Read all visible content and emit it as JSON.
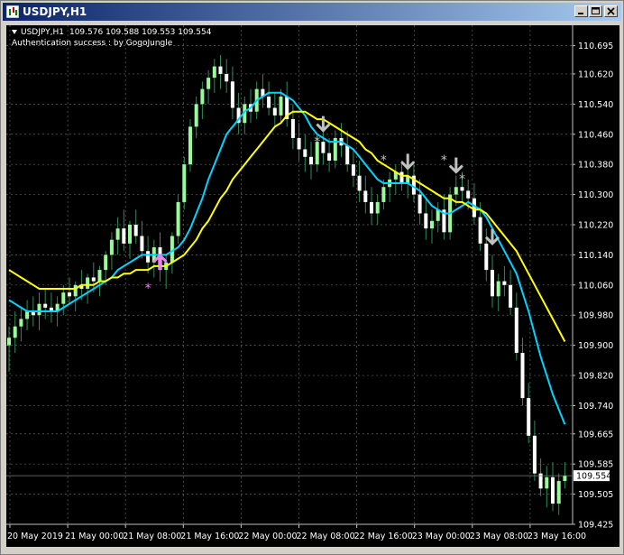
{
  "window": {
    "title": "USDJPY,H1"
  },
  "chart_header": {
    "symbol": "USDJPY,H1",
    "open": "109.576",
    "high": "109.588",
    "low": "109.553",
    "close": "109.554",
    "status": "Authentication success : by GogoJungle"
  },
  "colors": {
    "background": "#000000",
    "bull": "#98fb98",
    "bear": "#ffffff",
    "wick": "#2e8b57",
    "ma_fast": "#00d4ff",
    "ma_slow": "#ffff00",
    "grid": "#5a6a5a",
    "buy_arrow": "#ee82ee",
    "sell_arrow": "#c0c0c0"
  },
  "chart_data": {
    "type": "candlestick",
    "symbol": "USDJPY",
    "timeframe": "H1",
    "ylim": [
      109.425,
      110.73
    ],
    "y_ticks": [
      "110.695",
      "110.620",
      "110.540",
      "110.460",
      "110.380",
      "110.300",
      "110.220",
      "110.140",
      "110.060",
      "109.980",
      "109.900",
      "109.820",
      "109.740",
      "109.665",
      "109.585",
      "109.505",
      "109.425"
    ],
    "x_ticks": [
      "20 May 2019",
      "21 May 00:00",
      "21 May 08:00",
      "21 May 16:00",
      "22 May 00:00",
      "22 May 08:00",
      "22 May 16:00",
      "23 May 00:00",
      "23 May 08:00",
      "23 May 16:00"
    ],
    "current_price": "109.554",
    "ohlc": [
      [
        109.9,
        109.95,
        109.83,
        109.92
      ],
      [
        109.92,
        109.99,
        109.88,
        109.95
      ],
      [
        109.95,
        110.0,
        109.91,
        109.97
      ],
      [
        109.97,
        110.02,
        109.94,
        109.99
      ],
      [
        109.99,
        110.03,
        109.95,
        109.98
      ],
      [
        109.98,
        110.04,
        109.94,
        110.01
      ],
      [
        110.01,
        110.05,
        109.97,
        110.0
      ],
      [
        110.0,
        110.04,
        109.96,
        109.99
      ],
      [
        109.99,
        110.03,
        109.95,
        110.01
      ],
      [
        110.01,
        110.06,
        109.98,
        110.04
      ],
      [
        110.04,
        110.08,
        110.01,
        110.03
      ],
      [
        110.03,
        110.07,
        109.99,
        110.06
      ],
      [
        110.06,
        110.1,
        110.02,
        110.05
      ],
      [
        110.05,
        110.09,
        110.01,
        110.08
      ],
      [
        110.08,
        110.12,
        110.04,
        110.07
      ],
      [
        110.07,
        110.11,
        110.03,
        110.1
      ],
      [
        110.1,
        110.15,
        110.06,
        110.14
      ],
      [
        110.14,
        110.2,
        110.1,
        110.18
      ],
      [
        110.18,
        110.24,
        110.14,
        110.21
      ],
      [
        110.21,
        110.26,
        110.15,
        110.17
      ],
      [
        110.17,
        110.23,
        110.13,
        110.22
      ],
      [
        110.22,
        110.26,
        110.17,
        110.19
      ],
      [
        110.19,
        110.23,
        110.13,
        110.15
      ],
      [
        110.15,
        110.19,
        110.09,
        110.12
      ],
      [
        110.12,
        110.18,
        110.08,
        110.16
      ],
      [
        110.16,
        110.2,
        110.07,
        110.1
      ],
      [
        110.1,
        110.14,
        110.05,
        110.12
      ],
      [
        110.12,
        110.2,
        110.09,
        110.19
      ],
      [
        110.19,
        110.3,
        110.17,
        110.28
      ],
      [
        110.28,
        110.4,
        110.26,
        110.38
      ],
      [
        110.38,
        110.5,
        110.36,
        110.48
      ],
      [
        110.48,
        110.56,
        110.45,
        110.54
      ],
      [
        110.54,
        110.6,
        110.5,
        110.58
      ],
      [
        110.58,
        110.63,
        110.54,
        110.61
      ],
      [
        110.61,
        110.66,
        110.57,
        110.64
      ],
      [
        110.64,
        110.67,
        110.58,
        110.62
      ],
      [
        110.62,
        110.66,
        110.57,
        110.6
      ],
      [
        110.6,
        110.64,
        110.5,
        110.53
      ],
      [
        110.53,
        110.57,
        110.46,
        110.49
      ],
      [
        110.49,
        110.56,
        110.46,
        110.54
      ],
      [
        110.54,
        110.58,
        110.49,
        110.52
      ],
      [
        110.52,
        110.6,
        110.5,
        110.58
      ],
      [
        110.58,
        110.62,
        110.53,
        110.56
      ],
      [
        110.56,
        110.6,
        110.51,
        110.53
      ],
      [
        110.53,
        110.57,
        110.48,
        110.51
      ],
      [
        110.51,
        110.58,
        110.49,
        110.56
      ],
      [
        110.56,
        110.6,
        110.48,
        110.5
      ],
      [
        110.5,
        110.54,
        110.42,
        110.45
      ],
      [
        110.45,
        110.49,
        110.39,
        110.42
      ],
      [
        110.42,
        110.46,
        110.36,
        110.4
      ],
      [
        110.4,
        110.44,
        110.34,
        110.38
      ],
      [
        110.38,
        110.46,
        110.36,
        110.44
      ],
      [
        110.44,
        110.48,
        110.38,
        110.41
      ],
      [
        110.41,
        110.45,
        110.36,
        110.39
      ],
      [
        110.39,
        110.47,
        110.37,
        110.45
      ],
      [
        110.45,
        110.49,
        110.4,
        110.43
      ],
      [
        110.43,
        110.47,
        110.36,
        110.38
      ],
      [
        110.38,
        110.42,
        110.32,
        110.35
      ],
      [
        110.35,
        110.39,
        110.28,
        110.31
      ],
      [
        110.31,
        110.35,
        110.25,
        110.28
      ],
      [
        110.28,
        110.32,
        110.22,
        110.25
      ],
      [
        110.25,
        110.3,
        110.22,
        110.28
      ],
      [
        110.28,
        110.34,
        110.26,
        110.32
      ],
      [
        110.32,
        110.36,
        110.28,
        110.34
      ],
      [
        110.34,
        110.38,
        110.3,
        110.36
      ],
      [
        110.36,
        110.39,
        110.31,
        110.33
      ],
      [
        110.33,
        110.37,
        110.29,
        110.35
      ],
      [
        110.35,
        110.38,
        110.28,
        110.3
      ],
      [
        110.3,
        110.34,
        110.22,
        110.25
      ],
      [
        110.25,
        110.29,
        110.18,
        110.21
      ],
      [
        110.21,
        110.26,
        110.17,
        110.23
      ],
      [
        110.23,
        110.28,
        110.2,
        110.26
      ],
      [
        110.26,
        110.3,
        110.18,
        110.2
      ],
      [
        110.2,
        110.32,
        110.18,
        110.3
      ],
      [
        110.3,
        110.35,
        110.27,
        110.32
      ],
      [
        110.32,
        110.36,
        110.28,
        110.31
      ],
      [
        110.31,
        110.34,
        110.26,
        110.29
      ],
      [
        110.29,
        110.33,
        110.22,
        110.24
      ],
      [
        110.24,
        110.28,
        110.15,
        110.17
      ],
      [
        110.17,
        110.21,
        110.07,
        110.1
      ],
      [
        110.1,
        110.14,
        110.0,
        110.03
      ],
      [
        110.03,
        110.09,
        109.99,
        110.07
      ],
      [
        110.07,
        110.11,
        110.03,
        110.06
      ],
      [
        110.06,
        110.1,
        109.98,
        110.0
      ],
      [
        110.0,
        110.04,
        109.86,
        109.88
      ],
      [
        109.88,
        109.92,
        109.74,
        109.76
      ],
      [
        109.76,
        109.8,
        109.64,
        109.66
      ],
      [
        109.66,
        109.7,
        109.54,
        109.56
      ],
      [
        109.56,
        109.6,
        109.5,
        109.52
      ],
      [
        109.52,
        109.58,
        109.47,
        109.55
      ],
      [
        109.55,
        109.59,
        109.46,
        109.48
      ],
      [
        109.48,
        109.56,
        109.45,
        109.54
      ],
      [
        109.54,
        109.59,
        109.52,
        109.554
      ]
    ],
    "series": [
      {
        "values": [
          110.02,
          110.01,
          110.0,
          109.99,
          109.99,
          109.99,
          109.99,
          109.99,
          109.99,
          110.0,
          110.01,
          110.02,
          110.03,
          110.04,
          110.05,
          110.06,
          110.07,
          110.08,
          110.1,
          110.11,
          110.12,
          110.13,
          110.14,
          110.14,
          110.14,
          110.14,
          110.14,
          110.15,
          110.16,
          110.18,
          110.21,
          110.25,
          110.29,
          110.34,
          110.38,
          110.42,
          110.46,
          110.48,
          110.5,
          110.52,
          110.53,
          110.55,
          110.56,
          110.57,
          110.57,
          110.57,
          110.56,
          110.55,
          110.53,
          110.51,
          110.48,
          110.46,
          110.45,
          110.44,
          110.44,
          110.44,
          110.43,
          110.42,
          110.4,
          110.38,
          110.36,
          110.34,
          110.33,
          110.33,
          110.33,
          110.33,
          110.33,
          110.32,
          110.31,
          110.29,
          110.27,
          110.26,
          110.25,
          110.25,
          110.26,
          110.27,
          110.28,
          110.27,
          110.26,
          110.24,
          110.21,
          110.18,
          110.15,
          110.12,
          110.09,
          110.04,
          109.99,
          109.93,
          109.87,
          109.82,
          109.77,
          109.73,
          109.69
        ]
      },
      {
        "values": [
          110.1,
          110.09,
          110.08,
          110.07,
          110.06,
          110.05,
          110.05,
          110.05,
          110.05,
          110.05,
          110.05,
          110.05,
          110.06,
          110.06,
          110.06,
          110.07,
          110.07,
          110.08,
          110.08,
          110.09,
          110.09,
          110.1,
          110.1,
          110.1,
          110.11,
          110.11,
          110.11,
          110.12,
          110.13,
          110.14,
          110.16,
          110.18,
          110.21,
          110.23,
          110.26,
          110.29,
          110.31,
          110.34,
          110.36,
          110.38,
          110.4,
          110.42,
          110.44,
          110.46,
          110.48,
          110.49,
          110.51,
          110.52,
          110.52,
          110.52,
          110.51,
          110.5,
          110.5,
          110.49,
          110.48,
          110.47,
          110.46,
          110.45,
          110.44,
          110.42,
          110.41,
          110.39,
          110.38,
          110.37,
          110.36,
          110.35,
          110.35,
          110.34,
          110.33,
          110.32,
          110.31,
          110.3,
          110.29,
          110.29,
          110.28,
          110.28,
          110.27,
          110.26,
          110.26,
          110.25,
          110.23,
          110.21,
          110.19,
          110.17,
          110.15,
          110.12,
          110.09,
          110.06,
          110.03,
          110.0,
          109.97,
          109.94,
          109.91
        ]
      }
    ],
    "signals": [
      {
        "type": "buy",
        "bar": 25,
        "price": 110.1
      },
      {
        "type": "sell",
        "bar": 52,
        "price": 110.47
      },
      {
        "type": "sell",
        "bar": 66,
        "price": 110.37
      },
      {
        "type": "sell",
        "bar": 74,
        "price": 110.36
      },
      {
        "type": "sell",
        "bar": 80,
        "price": 110.17
      }
    ],
    "markers": [
      {
        "type": "buy-star",
        "bar": 23,
        "price": 110.04
      },
      {
        "type": "sell-star",
        "bar": 51,
        "price": 110.43
      },
      {
        "type": "sell-star",
        "bar": 62,
        "price": 110.38
      },
      {
        "type": "sell-star",
        "bar": 72,
        "price": 110.38
      },
      {
        "type": "sell-star",
        "bar": 75,
        "price": 110.33
      }
    ],
    "grid": true
  }
}
